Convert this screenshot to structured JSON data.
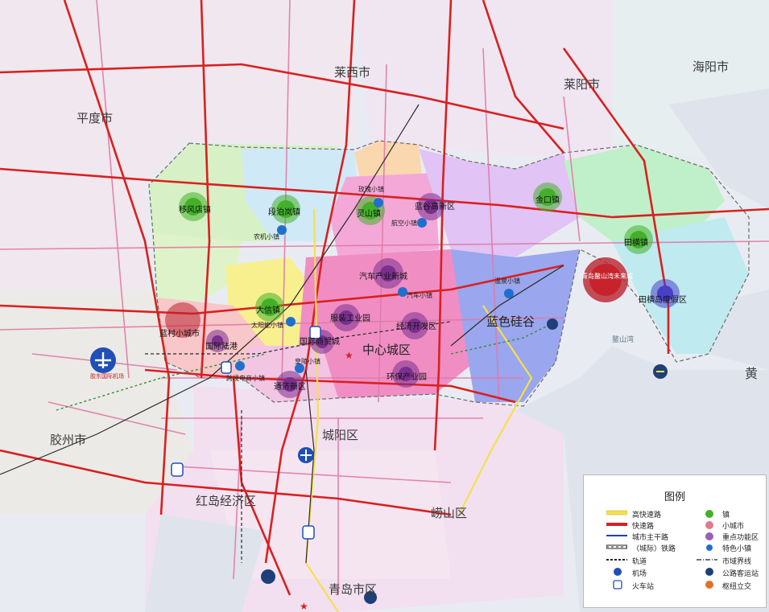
{
  "map": {
    "cities": {
      "laixi": "莱西市",
      "laiyang": "莱阳市",
      "haiyang": "海阳市",
      "pingdu": "平度市",
      "jiaozhou": "胶州市",
      "chengyang": "城阳区",
      "hongdao": "红岛经济区",
      "laoshan": "崂山区",
      "qingdao": "青岛市区"
    },
    "areas": {
      "zhongxin": "中心城区",
      "lanse": "蓝色硅谷"
    },
    "towns": {
      "yifengdian": "移风店镇",
      "duanbolan": "段泊岚镇",
      "lingshan": "灵山镇",
      "jinkou": "金口镇",
      "tianheng": "田横镇",
      "daxin": "大信镇"
    },
    "small_cities": {
      "lancun": "蓝村小城市",
      "jimo_future": "青岛鳌山湾未来城"
    },
    "functional_zones": {
      "langu": "蓝谷高新区",
      "qiche": "汽车产业新城",
      "fuzhuang": "服装工业园",
      "jingji": "经济开发区",
      "guojilugang": "国际陆港",
      "guojishangmao": "国际商贸城",
      "tongji": "通济新区",
      "huanbao": "环保产业园",
      "tianhengdao": "田横岛度假区"
    },
    "featured_towns": {
      "meigui": "玫瑰小镇",
      "hangkong": "航空小镇",
      "nongji": "农机小镇",
      "qiche_town": "汽车小镇",
      "wenquan": "温泉小镇",
      "taiyangneng": "太阳能小镇",
      "huangdi": "皇陵小镇",
      "kuajing": "跨境电商小镇"
    },
    "airport": "胶东国际机场",
    "sea": "黄",
    "bay": "鳌山湾",
    "colors": {
      "expressway": "#d92020",
      "highway": "#f5e04a",
      "mainroad": "#d13a7a",
      "rail": "#2a2a2a",
      "town": "#43b02a",
      "zone": "#7a2f8f",
      "feature": "#1f6fd0"
    }
  },
  "legend": {
    "title": "图例",
    "items": [
      {
        "label": "高快速路",
        "symbol": "highway"
      },
      {
        "label": "快速路",
        "symbol": "expressway"
      },
      {
        "label": "城市主干路",
        "symbol": "mainroad"
      },
      {
        "label": "（城际）铁路",
        "symbol": "railway"
      },
      {
        "label": "轨道",
        "symbol": "metro"
      },
      {
        "label": "机场",
        "symbol": "airport-icon"
      },
      {
        "label": "火车站",
        "symbol": "train-icon"
      },
      {
        "label": "镇",
        "symbol": "town-dot"
      },
      {
        "label": "小城市",
        "symbol": "smallcity-dot"
      },
      {
        "label": "重点功能区",
        "symbol": "zone-dot"
      },
      {
        "label": "特色小镇",
        "symbol": "feature-dot"
      },
      {
        "label": "市域界线",
        "symbol": "boundary"
      },
      {
        "label": "公路客运站",
        "symbol": "bus-icon"
      },
      {
        "label": "枢纽立交",
        "symbol": "interchange-icon"
      }
    ]
  }
}
